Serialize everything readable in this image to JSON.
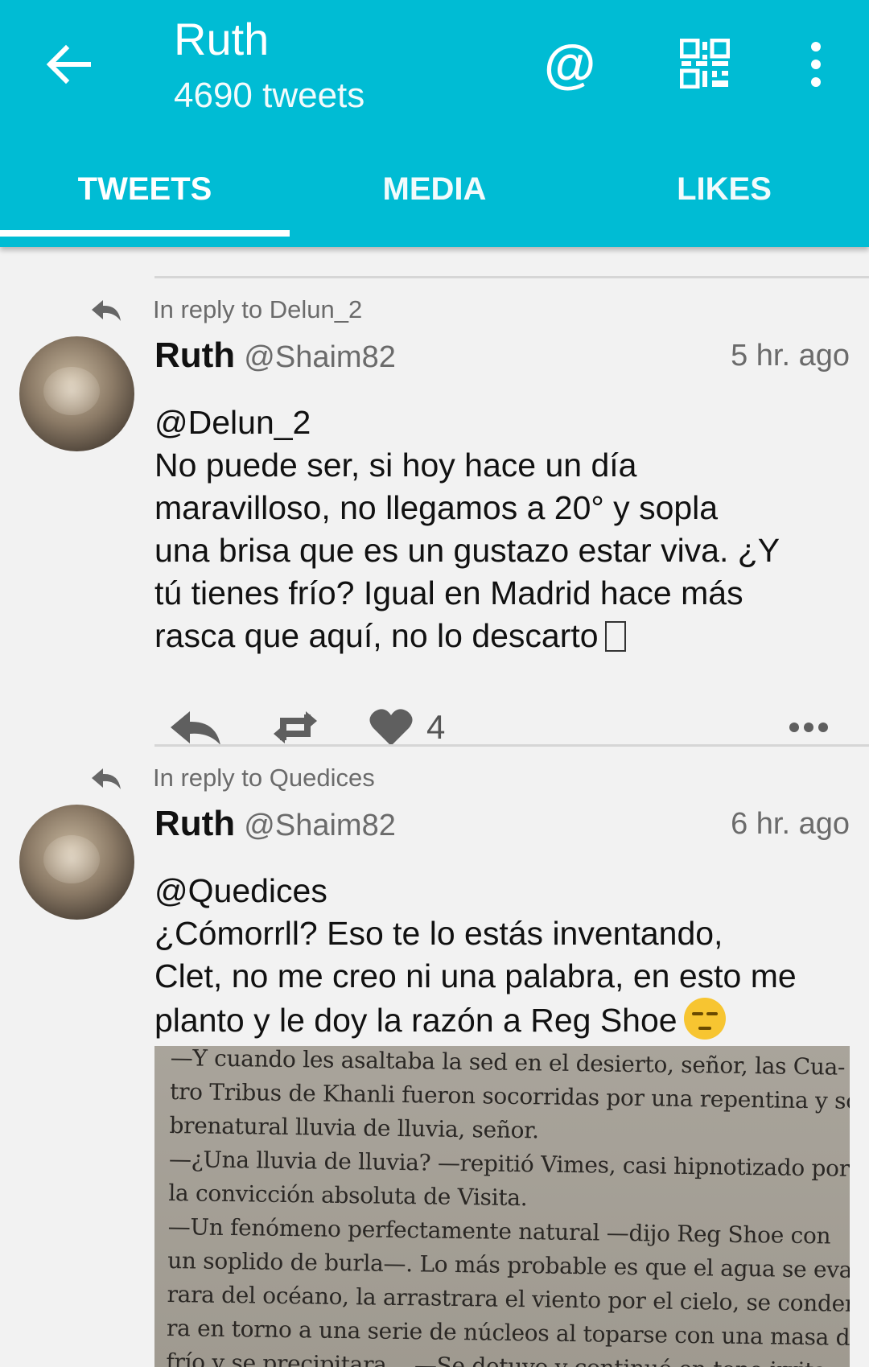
{
  "header": {
    "title": "Ruth",
    "subtitle": "4690 tweets"
  },
  "tabs": [
    {
      "label": "TWEETS",
      "active": true
    },
    {
      "label": "MEDIA",
      "active": false
    },
    {
      "label": "LIKES",
      "active": false
    }
  ],
  "accent_color": "#00bcd4",
  "icons": {
    "back": "arrow-left-icon",
    "mention": "at-sign-icon",
    "qr": "qr-code-icon",
    "overflow": "more-vertical-icon"
  },
  "tweets": [
    {
      "reply_to": "In reply to Delun_2",
      "name": "Ruth",
      "handle": "@Shaim82",
      "time": "5 hr. ago",
      "text": "@Delun_2\nNo puede ser, si hoy hace un día\nmaravilloso, no llegamos a 20° y sopla\nuna brisa que es un gustazo estar viva. ¿Y\ntú tienes frío? Igual en Madrid hace más\nrasca que aquí, no lo descarto",
      "likes": "4"
    },
    {
      "reply_to": "In reply to Quedices",
      "name": "Ruth",
      "handle": "@Shaim82",
      "time": "6 hr. ago",
      "text": "@Quedices\n¿Cómorrll? Eso te lo estás inventando,\nClet, no me creo ni una palabra, en esto me\nplanto y le doy la razón a Reg Shoe",
      "image_text": [
        "—Y cuando les asaltaba la sed en el desierto, señor, las Cua-",
        "tro Tribus de Khanli fueron socorridas por una repentina y so-",
        "brenatural lluvia de lluvia, señor.",
        "—¿Una lluvia de lluvia? —repitió Vimes, casi hipnotizado por",
        "la convicción absoluta de Visita.",
        "—Un fenómeno perfectamente natural —dijo Reg Shoe con",
        "un soplido de burla—. Lo más probable es que el agua se evapo-",
        "rara del océano, la arrastrara el viento por el cielo, se condensa-",
        "ra en torno a una serie de núcleos al toparse con una masa de aire",
        "frío y se precipitara... —Se detuvo y continuó en tono irrita-"
      ]
    }
  ]
}
